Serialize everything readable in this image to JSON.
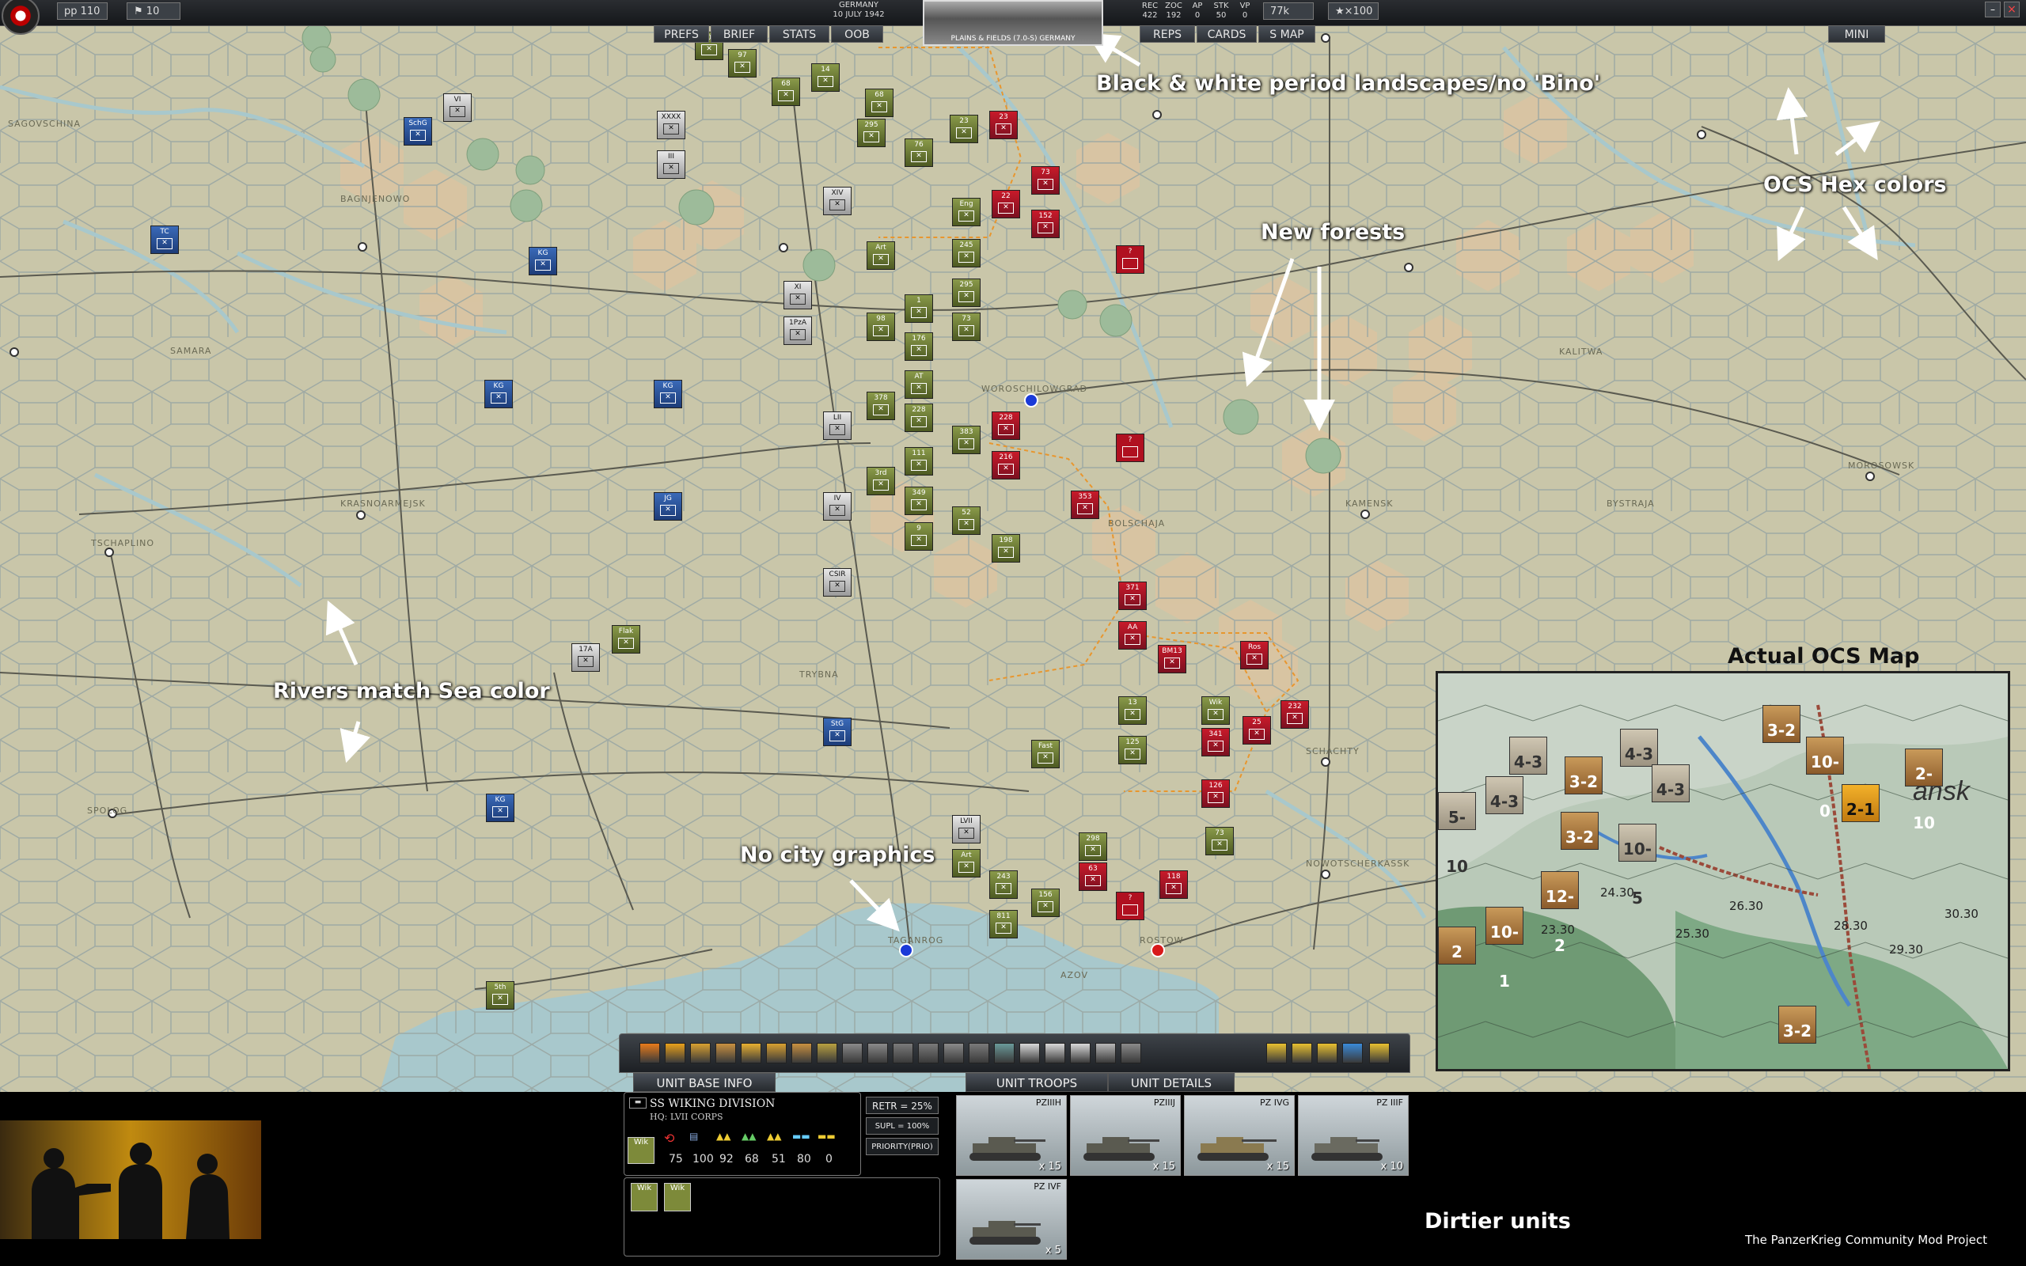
{
  "topbar": {
    "pp": "pp 110",
    "turns": "10",
    "nation": "GERMANY",
    "date": "10 JULY 1942",
    "weather_caption": "PLAINS & FIELDS (7.0-S) GERMANY",
    "stats": [
      {
        "label": "REC",
        "value": "422"
      },
      {
        "label": "ZOC",
        "value": "192"
      },
      {
        "label": "AP",
        "value": "0"
      },
      {
        "label": "STK",
        "value": "50"
      },
      {
        "label": "VP",
        "value": "0"
      }
    ],
    "prestige": "77k",
    "stars": "★×100"
  },
  "menus": {
    "prefs": "PREFS",
    "brief": "BRIEF",
    "stats": "STATS",
    "oob": "OOB",
    "reps": "REPS",
    "cards": "CARDS",
    "smap": "S MAP",
    "mini": "MINI"
  },
  "annotations": {
    "bw": "Black & white period landscapes/no 'Bino'",
    "hex": "OCS Hex colors",
    "forests": "New forests",
    "rivers": "Rivers match Sea color",
    "city": "No city graphics",
    "actual": "Actual OCS Map",
    "dirtier": "Dirtier units",
    "credit": "The PanzerKrieg Community Mod Project"
  },
  "cities": [
    {
      "name": "SAGOVSCHINA"
    },
    {
      "name": "BAGNJENOWO"
    },
    {
      "name": "SAMARA"
    },
    {
      "name": "BOLSCHAJA"
    },
    {
      "name": "KALITWA"
    },
    {
      "name": "BYSTRAJA"
    },
    {
      "name": "TSCHAPLINO"
    },
    {
      "name": "KRASNOARMEJSK"
    },
    {
      "name": "SPOLOG"
    },
    {
      "name": "TRYBNA"
    },
    {
      "name": "TAGANROG"
    },
    {
      "name": "ROSTOW"
    },
    {
      "name": "AZOV"
    },
    {
      "name": "NOWOTSCHERKASSK"
    },
    {
      "name": "MOROSOWSK"
    },
    {
      "name": "WOROSCHILOWGRAD"
    },
    {
      "name": "KAMENSK"
    },
    {
      "name": "SCHACHTY"
    }
  ],
  "units_axis": [
    "101",
    "97",
    "68",
    "14",
    "295",
    "76",
    "68",
    "23",
    "245",
    "1",
    "295",
    "73",
    "98",
    "176",
    "AT",
    "228",
    "378",
    "383",
    "111",
    "349",
    "3rd",
    "52",
    "9",
    "198",
    "Eng",
    "Art",
    "17A",
    "Flak",
    "CSIR",
    "XIV",
    "XI",
    "1PzA",
    "LII",
    "IV",
    "VI",
    "XXXX",
    "III",
    "SchG",
    "TC",
    "KG",
    "KG",
    "KG",
    "JG",
    "KG",
    "StG",
    "5th",
    "Wik",
    "125",
    "13",
    "73",
    "298",
    "156",
    "811",
    "243",
    "LVII",
    "Art",
    "Fast"
  ],
  "units_soviet": [
    "23",
    "22",
    "73",
    "152",
    "228",
    "216",
    "353",
    "371",
    "AA",
    "Ros",
    "232",
    "25",
    "341",
    "126",
    "63",
    "118",
    "BM13",
    "?",
    "?",
    "?"
  ],
  "toolbar_tabs": {
    "base": "UNIT BASE INFO",
    "troops": "UNIT TROOPS",
    "details": "UNIT DETAILS"
  },
  "unit_info": {
    "name": "SS WIKING DIVISION",
    "hq": "HQ: LVII CORPS",
    "values": [
      "75",
      "100",
      "92",
      "68",
      "51",
      "80",
      "0"
    ],
    "retr": "RETR = 25%",
    "supl": "SUPL = 100%(100%)",
    "priority": "PRIORITY(PRIO)",
    "subunits": [
      "Wik",
      "Wik"
    ]
  },
  "troops": [
    {
      "name": "PZIIIH",
      "count": "x 15"
    },
    {
      "name": "PZIIIJ",
      "count": "x 15"
    },
    {
      "name": "PZ IVG",
      "count": "x 15"
    },
    {
      "name": "PZ IIIF",
      "count": "x 10"
    },
    {
      "name": "PZ IVF",
      "count": "x 5"
    }
  ],
  "inset_counters": [
    "3-2",
    "4-3",
    "3-2",
    "4-3",
    "4-3",
    "10-0",
    "2-10",
    "5-10",
    "4-3",
    "3-2",
    "10-5",
    "2-1",
    "12-2",
    "10-1",
    "2",
    "3-2"
  ],
  "inset_hexnums": [
    "24.30",
    "23.30",
    "25.30",
    "26.30",
    "28.30",
    "30.30",
    "29.30"
  ],
  "colors": {
    "map": "#c9c6a9",
    "sea": "#a8c8cc",
    "steppe": "#d9c4a2",
    "axis": "#7d8a3a",
    "soviet": "#7a1020"
  }
}
